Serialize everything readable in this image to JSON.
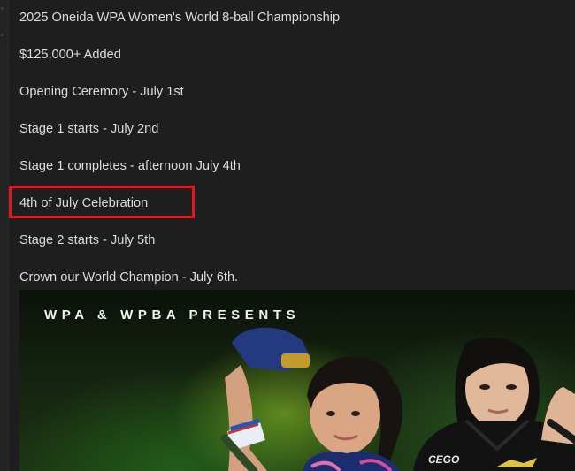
{
  "post": {
    "lines": [
      "2025 Oneida WPA Women's World 8-ball Championship",
      "$125,000+ Added",
      "Opening Ceremory - July 1st",
      "Stage 1 starts - July 2nd",
      "Stage 1 completes - afternoon July 4th",
      "4th of July Celebration",
      "Stage 2 starts - July 5th",
      "Crown our World Champion - July 6th."
    ],
    "highlighted_index": 5
  },
  "poster": {
    "heading": "WPA & WPBA PRESENTS",
    "sponsor_logo_text": "CEGO"
  },
  "colors": {
    "background": "#1e1e1f",
    "text": "#dcdcdc",
    "highlight": "#e3161b",
    "poster_green": "#2f6a1c"
  }
}
